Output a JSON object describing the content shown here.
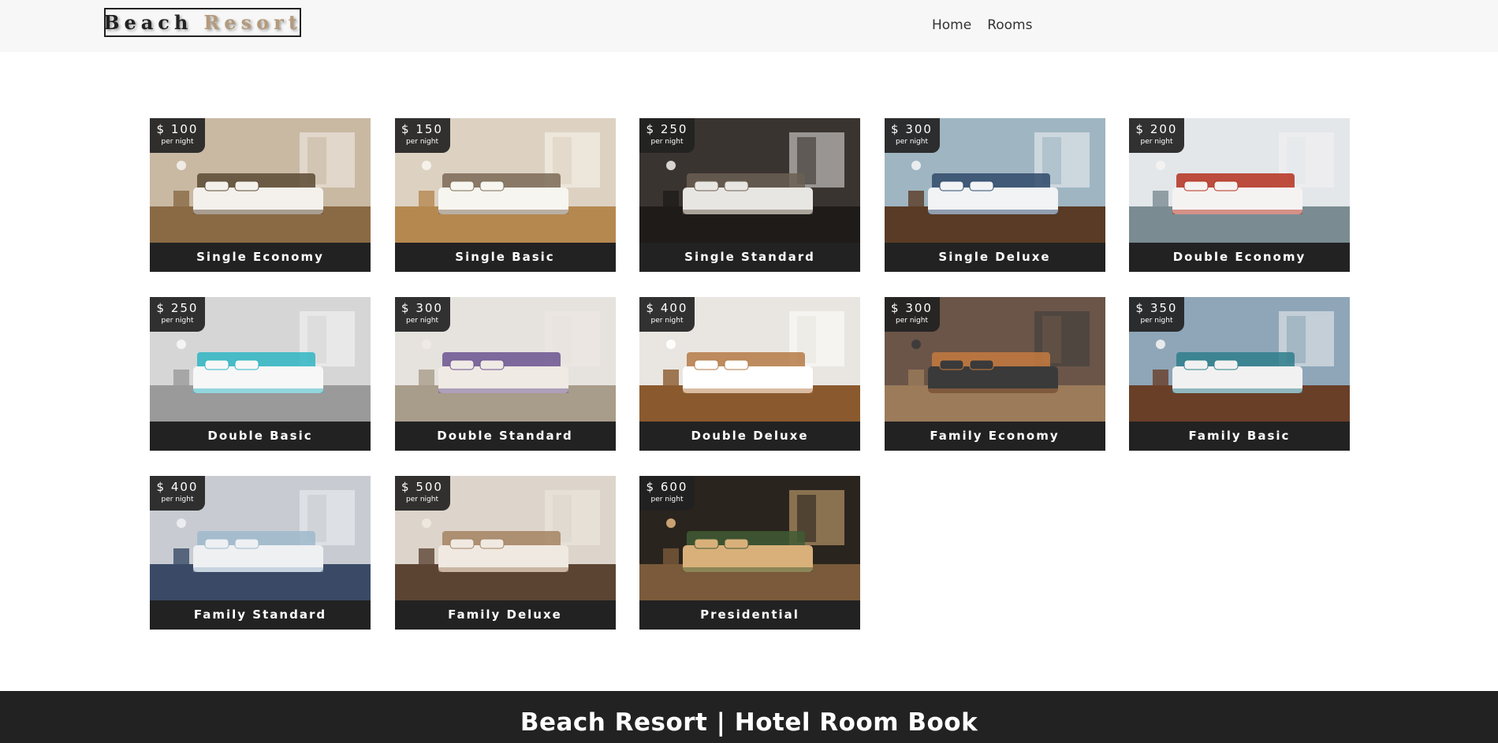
{
  "brand": {
    "word1": "Beach",
    "word2": "Resort"
  },
  "nav": {
    "home": "Home",
    "rooms": "Rooms"
  },
  "price_unit": "per night",
  "rooms": [
    {
      "name": "Single Economy",
      "price": "$ 100",
      "palette": [
        "#c9b9a3",
        "#8a6a45",
        "#f4f1ec",
        "#5c4a34"
      ]
    },
    {
      "name": "Single Basic",
      "price": "$ 150",
      "palette": [
        "#ddd2c2",
        "#b58850",
        "#f7f5f0",
        "#7b6a56"
      ]
    },
    {
      "name": "Single Standard",
      "price": "$ 250",
      "palette": [
        "#3a3430",
        "#1e1b19",
        "#e8e6e3",
        "#6b5f52"
      ]
    },
    {
      "name": "Single Deluxe",
      "price": "$ 300",
      "palette": [
        "#9fb5c2",
        "#5a3b25",
        "#f2f3f5",
        "#2f4a6a"
      ]
    },
    {
      "name": "Double Economy",
      "price": "$ 200",
      "palette": [
        "#e3e7ea",
        "#7a8c92",
        "#f5f3f2",
        "#b5301e"
      ]
    },
    {
      "name": "Double Basic",
      "price": "$ 250",
      "palette": [
        "#d6d6d6",
        "#9a9a9a",
        "#f7f7f7",
        "#2fb6c4"
      ]
    },
    {
      "name": "Double Standard",
      "price": "$ 300",
      "palette": [
        "#e6e3de",
        "#a89c8a",
        "#efeae4",
        "#6b5390"
      ]
    },
    {
      "name": "Double Deluxe",
      "price": "$ 400",
      "palette": [
        "#e9e6e1",
        "#8a5a2e",
        "#ffffff",
        "#b57a45"
      ]
    },
    {
      "name": "Family Economy",
      "price": "$ 300",
      "palette": [
        "#6a5548",
        "#9b7b5a",
        "#3a3a3a",
        "#c47a3f"
      ]
    },
    {
      "name": "Family Basic",
      "price": "$ 350",
      "palette": [
        "#8ea6b8",
        "#6a3f28",
        "#f1f1f1",
        "#2f7e8c"
      ]
    },
    {
      "name": "Family Standard",
      "price": "$ 400",
      "palette": [
        "#c8ccd2",
        "#3a4a66",
        "#eef0f2",
        "#9fb8cc"
      ]
    },
    {
      "name": "Family Deluxe",
      "price": "$ 500",
      "palette": [
        "#ddd5cb",
        "#5c4433",
        "#efe9e1",
        "#a48262"
      ]
    },
    {
      "name": "Presidential",
      "price": "$ 600",
      "palette": [
        "#2a241e",
        "#7a5a3a",
        "#d9b07a",
        "#3f5a34"
      ]
    }
  ],
  "footer": {
    "title": "Beach Resort | Hotel Room Book"
  }
}
